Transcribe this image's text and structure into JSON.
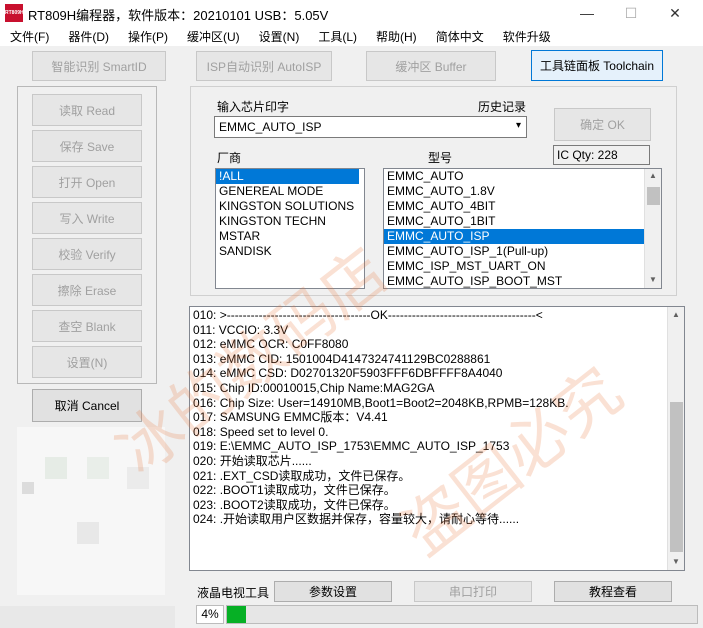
{
  "window": {
    "title": "RT809H编程器，软件版本：20210101  USB：5.05V",
    "logo_text": "RT809H",
    "minimize": "—",
    "maximize": "☐",
    "close": "✕"
  },
  "menu": [
    "文件(F)",
    "器件(D)",
    "操作(P)",
    "缓冲区(U)",
    "设置(N)",
    "工具(L)",
    "帮助(H)",
    "简体中文",
    "软件升级"
  ],
  "toolbar": {
    "smart_id": "智能识别 SmartID",
    "isp_auto": "ISP自动识别 AutoISP",
    "buffer": "缓冲区 Buffer",
    "toolchain": "工具链面板 Toolchain"
  },
  "side": {
    "read": "读取 Read",
    "save": "保存 Save",
    "open": "打开 Open",
    "write": "写入 Write",
    "verify": "校验 Verify",
    "erase": "擦除 Erase",
    "blank": "查空 Blank",
    "settings": "设置(N)",
    "cancel": "取消 Cancel"
  },
  "chip": {
    "input_label": "输入芯片印字",
    "history_label": "历史记录",
    "input_value": "EMMC_AUTO_ISP",
    "confirm": "确定 OK",
    "qty": "IC Qty: 228",
    "vendor_label": "厂商",
    "model_label": "型号",
    "vendors": [
      "!ALL",
      "GENEREAL MODE",
      "KINGSTON SOLUTIONS",
      "KINGSTON TECHN",
      "MSTAR",
      "SANDISK"
    ],
    "models": [
      "EMMC_AUTO",
      "EMMC_AUTO_1.8V",
      "EMMC_AUTO_4BIT",
      "EMMC_AUTO_1BIT",
      "EMMC_AUTO_ISP",
      "EMMC_AUTO_ISP_1(Pull-up)",
      "EMMC_ISP_MST_UART_ON",
      "EMMC_AUTO_ISP_BOOT_MST"
    ]
  },
  "log": [
    "010:  >------------------------------------OK-------------------------------------<",
    "011:  VCCIO: 3.3V",
    "012:  eMMC OCR: C0FF8080",
    "013:  eMMC CID:  1501004D4147324741129BC0288861",
    "014:  eMMC CSD: D02701320F5903FFF6DBFFFF8A4040",
    "015:  Chip ID:00010015,Chip Name:MAG2GA",
    "016:  Chip Size: User=14910MB,Boot1=Boot2=2048KB,RPMB=128KB.",
    "017:  SAMSUNG EMMC版本：V4.41",
    "018:  Speed set to level 0.",
    "019:  E:\\EMMC_AUTO_ISP_1753\\EMMC_AUTO_ISP_1753",
    "020:  开始读取芯片......",
    "021:  .EXT_CSD读取成功，文件已保存。",
    "022:  .BOOT1读取成功，文件已保存。",
    "023:  .BOOT2读取成功，文件已保存。",
    "024:  .开始读取用户区数据并保存，容量较大，请耐心等待......"
  ],
  "bottom": {
    "tv_tools": "液晶电视工具",
    "param": "参数设置",
    "serial": "串口打印",
    "tutorial": "教程查看"
  },
  "progress": {
    "label": "4%",
    "fraction": 0.04,
    "color": "#06b025"
  },
  "watermark": [
    "冰的数码店",
    "盗图必究"
  ]
}
